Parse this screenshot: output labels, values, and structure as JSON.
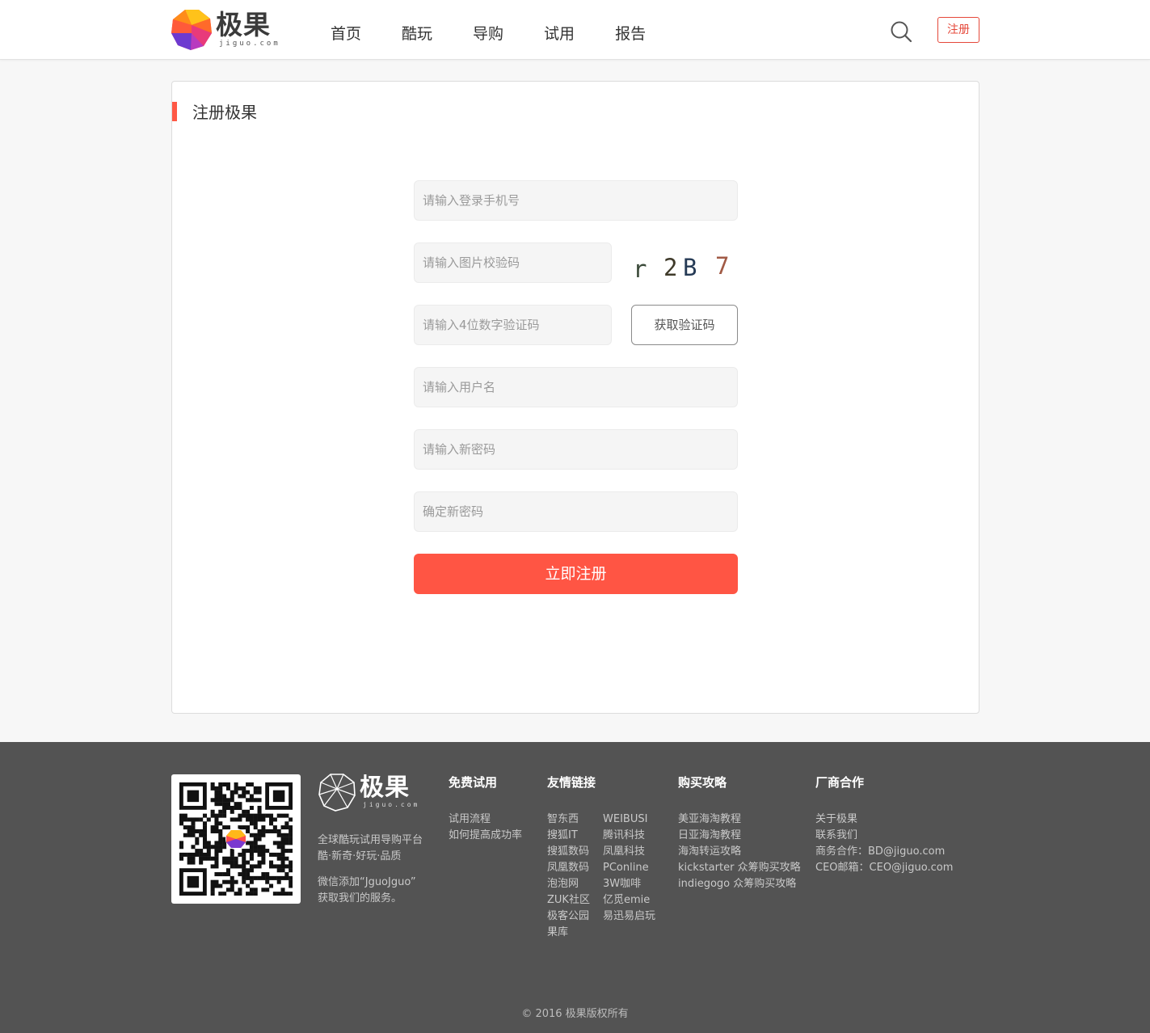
{
  "header": {
    "logo_text": "极果",
    "logo_sub": "jiguo.com",
    "nav": [
      "首页",
      "酷玩",
      "导购",
      "试用",
      "报告"
    ],
    "register_label": "注册"
  },
  "form": {
    "title": "注册极果",
    "phone_placeholder": "请输入登录手机号",
    "image_code_placeholder": "请输入图片校验码",
    "captcha_chars": [
      "r",
      "2",
      "B",
      "7"
    ],
    "sms_code_placeholder": "请输入4位数字验证码",
    "get_code_label": "获取验证码",
    "username_placeholder": "请输入用户名",
    "password_placeholder": "请输入新密码",
    "confirm_password_placeholder": "确定新密码",
    "submit_label": "立即注册"
  },
  "footer": {
    "logo_text": "极果",
    "logo_sub": "jiguo.com",
    "tagline_1": "全球酷玩试用导购平台",
    "tagline_2": "酷·新奇·好玩·品质",
    "wechat_1": "微信添加“JguoJguo”",
    "wechat_2": "获取我们的服务。",
    "columns": {
      "trial": {
        "title": "免费试用",
        "items": [
          "试用流程",
          "如何提高成功率"
        ]
      },
      "links": {
        "title": "友情链接",
        "col_a": [
          "智东西",
          "搜狐IT",
          "搜狐数码",
          "凤凰数码",
          "泡泡网",
          "ZUK社区",
          "极客公园",
          "果库"
        ],
        "col_b": [
          "WEIBUSI",
          "腾讯科技",
          "凤凰科技",
          "PConline",
          "3W咖啡",
          "亿觅emie",
          "易迅易启玩"
        ]
      },
      "guide": {
        "title": "购买攻略",
        "items": [
          "美亚海淘教程",
          "日亚海淘教程",
          "海淘转运攻略",
          "kickstarter 众筹购买攻略",
          "indiegogo 众筹购买攻略"
        ]
      },
      "business": {
        "title": "厂商合作",
        "items": [
          "关于极果",
          "联系我们",
          "商务合作：BD@jiguo.com",
          "CEO邮箱：CEO@jiguo.com"
        ]
      }
    },
    "copyright": "© 2016 极果版权所有"
  },
  "colors": {
    "accent": "#ff5544",
    "footer_bg": "#535353"
  }
}
